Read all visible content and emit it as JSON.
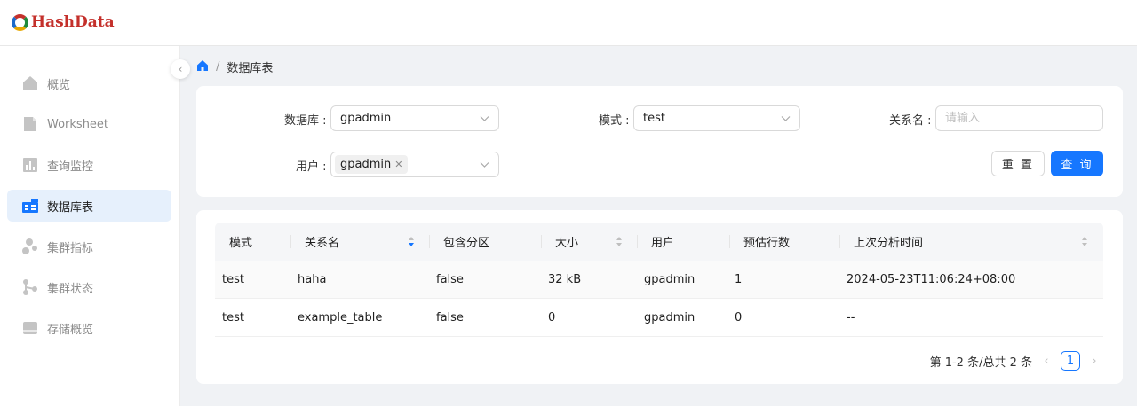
{
  "brand": {
    "name": "HashData"
  },
  "sidebar": {
    "items": [
      {
        "label": "概览",
        "icon": "home-icon",
        "active": false
      },
      {
        "label": "Worksheet",
        "icon": "document-icon",
        "active": false
      },
      {
        "label": "查询监控",
        "icon": "bar-chart-icon",
        "active": false
      },
      {
        "label": "数据库表",
        "icon": "database-table-icon",
        "active": true
      },
      {
        "label": "集群指标",
        "icon": "cluster-metrics-icon",
        "active": false
      },
      {
        "label": "集群状态",
        "icon": "cluster-status-icon",
        "active": false
      },
      {
        "label": "存储概览",
        "icon": "storage-icon",
        "active": false
      }
    ],
    "collapse_icon": "chevron-left-icon"
  },
  "breadcrumb": {
    "separator": "/",
    "current": "数据库表"
  },
  "filters": {
    "database": {
      "label": "数据库 :",
      "value": "gpadmin"
    },
    "schema": {
      "label": "模式 :",
      "value": "test"
    },
    "relation": {
      "label": "关系名 :",
      "placeholder": "请输入",
      "value": ""
    },
    "user": {
      "label": "用户 :",
      "tag": "gpadmin"
    },
    "reset_label": "重 置",
    "query_label": "查 询"
  },
  "table": {
    "columns": [
      "模式",
      "关系名",
      "包含分区",
      "大小",
      "用户",
      "预估行数",
      "上次分析时间"
    ],
    "rows": [
      [
        "test",
        "haha",
        "false",
        "32 kB",
        "gpadmin",
        "1",
        "2024-05-23T11:06:24+08:00"
      ],
      [
        "test",
        "example_table",
        "false",
        "0",
        "gpadmin",
        "0",
        "--"
      ]
    ]
  },
  "pagination": {
    "summary": "第 1-2 条/总共 2 条",
    "current_page": "1"
  },
  "colors": {
    "accent": "#1677ff",
    "active_bg": "#e6f0fc",
    "brand_red": "#c4302b"
  }
}
